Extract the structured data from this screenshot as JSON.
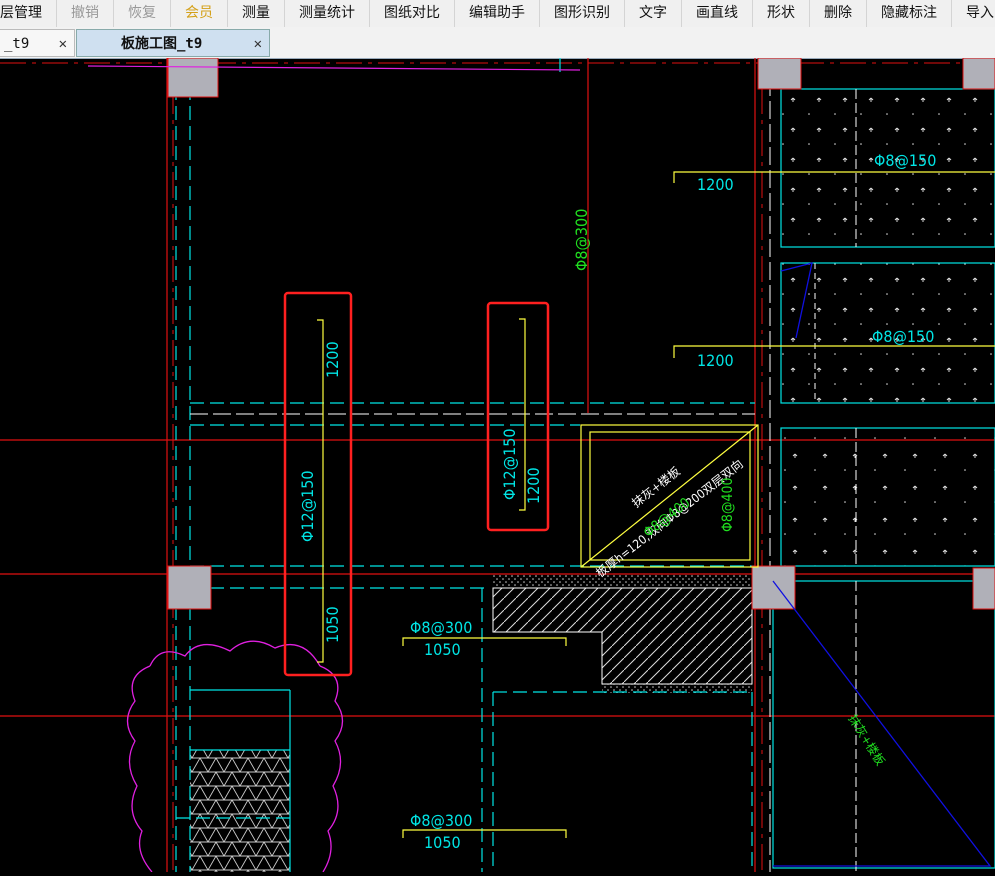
{
  "toolbar": {
    "items": [
      "层管理",
      "撤销",
      "恢复",
      "会员",
      "测量",
      "测量统计",
      "图纸对比",
      "编辑助手",
      "图形识别",
      "文字",
      "画直线",
      "形状",
      "删除",
      "隐藏标注",
      "导入"
    ]
  },
  "tabs": [
    {
      "label": "_t9",
      "close": "✕"
    },
    {
      "label": "板施工图_t9",
      "close": "✕"
    }
  ],
  "drawing": {
    "annotations": {
      "a1": "Φ8@150",
      "a2": "1200",
      "a3": "Φ8@150",
      "a4": "1200",
      "a5": "Φ8@300",
      "a6": "1200",
      "a7": "Φ12@150",
      "a8": "1050",
      "a9": "Φ12@150",
      "a10": "1200",
      "a11": "Φ8@300",
      "a12": "1050",
      "a13": "Φ8@300",
      "a14": "1050",
      "a15": "抹灰+楼板",
      "a16": "板厚h=120,双向Φ8@200双层双向",
      "a17": "Φ8@400",
      "a18": "Φ8@400",
      "a19": "抹灰+楼板"
    }
  },
  "colors": {
    "cyan": "#00e5e5",
    "red": "#e01010",
    "yellow": "#ffff40",
    "green": "#20e020",
    "magenta": "#e020e0",
    "blue": "#1010e0",
    "white": "#ffffff",
    "highlight": "#ff2020",
    "column": "#b0b0b8"
  }
}
